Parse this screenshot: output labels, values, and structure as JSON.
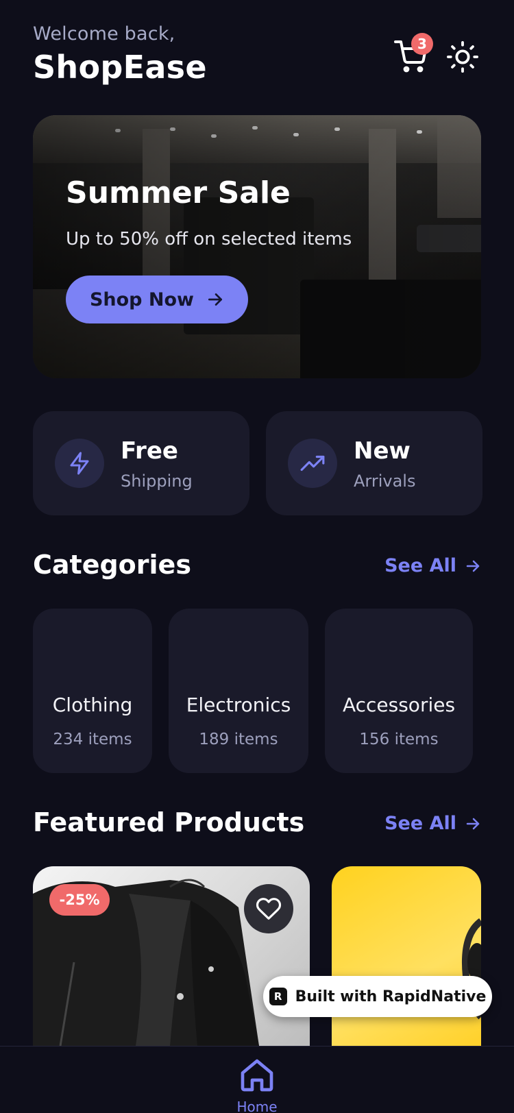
{
  "header": {
    "welcome": "Welcome back,",
    "brand": "ShopEase",
    "cart_count": "3"
  },
  "hero": {
    "title": "Summer Sale",
    "subtitle": "Up to 50% off on selected items",
    "button_label": "Shop Now"
  },
  "features": [
    {
      "title": "Free",
      "subtitle": "Shipping",
      "icon": "lightning-icon"
    },
    {
      "title": "New",
      "subtitle": "Arrivals",
      "icon": "trending-up-icon"
    }
  ],
  "categories_section": {
    "title": "Categories",
    "see_all": "See All",
    "items": [
      {
        "name": "Clothing",
        "count": "234 items"
      },
      {
        "name": "Electronics",
        "count": "189 items"
      },
      {
        "name": "Accessories",
        "count": "156 items"
      }
    ]
  },
  "featured_section": {
    "title": "Featured Products",
    "see_all": "See All",
    "products": [
      {
        "discount": "-25%"
      }
    ]
  },
  "built_with": "Built with RapidNative",
  "tabbar": {
    "home_label": "Home"
  },
  "colors": {
    "accent": "#7c82f5",
    "background": "#0e0e1a",
    "card": "#1a1a2a",
    "badge": "#f06a6a"
  }
}
